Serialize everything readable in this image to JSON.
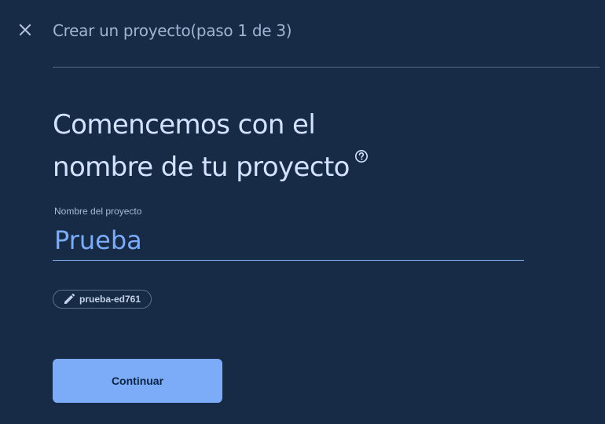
{
  "header": {
    "close_icon": "close-icon",
    "title": "Crear un proyecto(paso 1 de 3)"
  },
  "main": {
    "heading_line1": "Comencemos con el",
    "heading_line2": "nombre de tu proyecto",
    "help_icon": "help-circle-icon",
    "project_name_field": {
      "label": "Nombre del proyecto",
      "value": "Prueba"
    },
    "project_id_chip": {
      "icon": "edit-pencil-icon",
      "value": "prueba-ed761"
    },
    "continue_label": "Continuar"
  },
  "colors": {
    "background": "#172a46",
    "accent": "#7cacf8",
    "heading": "#d3e3fd"
  }
}
